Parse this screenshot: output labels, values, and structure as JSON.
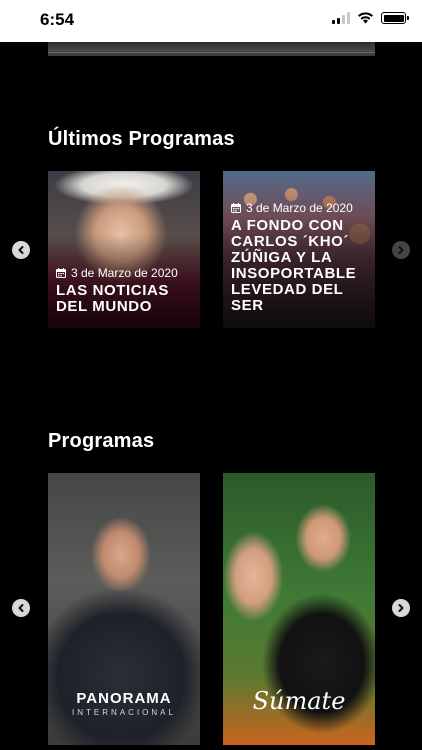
{
  "status_bar": {
    "time": "6:54"
  },
  "sections": {
    "latest": {
      "title": "Últimos Programas",
      "cards": [
        {
          "date": "3 de Marzo de 2020",
          "title": "LAS NOTICIAS DEL MUNDO"
        },
        {
          "date": "3 de Marzo de 2020",
          "title": "A FONDO CON CARLOS ´KHO´ ZÚÑIGA Y LA INSOPORTABLE LEVEDAD DEL SER"
        }
      ]
    },
    "programs": {
      "title": "Programas",
      "cards": [
        {
          "logo": "PANORAMA",
          "logo_sub": "INTERNACIONAL"
        },
        {
          "logo": "Súmate"
        }
      ]
    }
  },
  "icons": {
    "calendar": "calendar-icon",
    "prev": "chevron-left-icon",
    "next": "chevron-right-icon"
  }
}
